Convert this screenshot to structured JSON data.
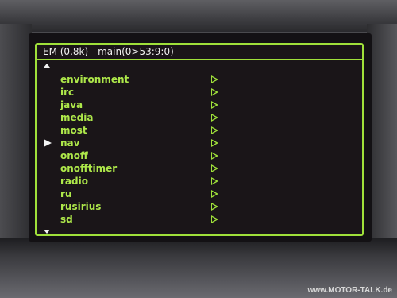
{
  "window": {
    "title": "EM (0.8k) - main(0>53:9:0)"
  },
  "menu": {
    "selected_index": 5,
    "items": [
      {
        "label": "environment"
      },
      {
        "label": "irc"
      },
      {
        "label": "java"
      },
      {
        "label": "media"
      },
      {
        "label": "most"
      },
      {
        "label": "nav"
      },
      {
        "label": "onoff"
      },
      {
        "label": "onofftimer"
      },
      {
        "label": "radio"
      },
      {
        "label": "ru"
      },
      {
        "label": "rusirius"
      },
      {
        "label": "sd"
      }
    ]
  },
  "icons": {
    "scroll_up": "triangle-up-icon",
    "scroll_down": "triangle-down-icon",
    "cursor": "selection-arrow-icon",
    "submenu": "outline-triangle-right-icon"
  },
  "colors": {
    "accent_green": "#9fe03a",
    "label_green": "#aee84a",
    "background": "#1a1518",
    "title_text": "#f2f2f2"
  },
  "watermark": "www.MOTOR-TALK.de"
}
